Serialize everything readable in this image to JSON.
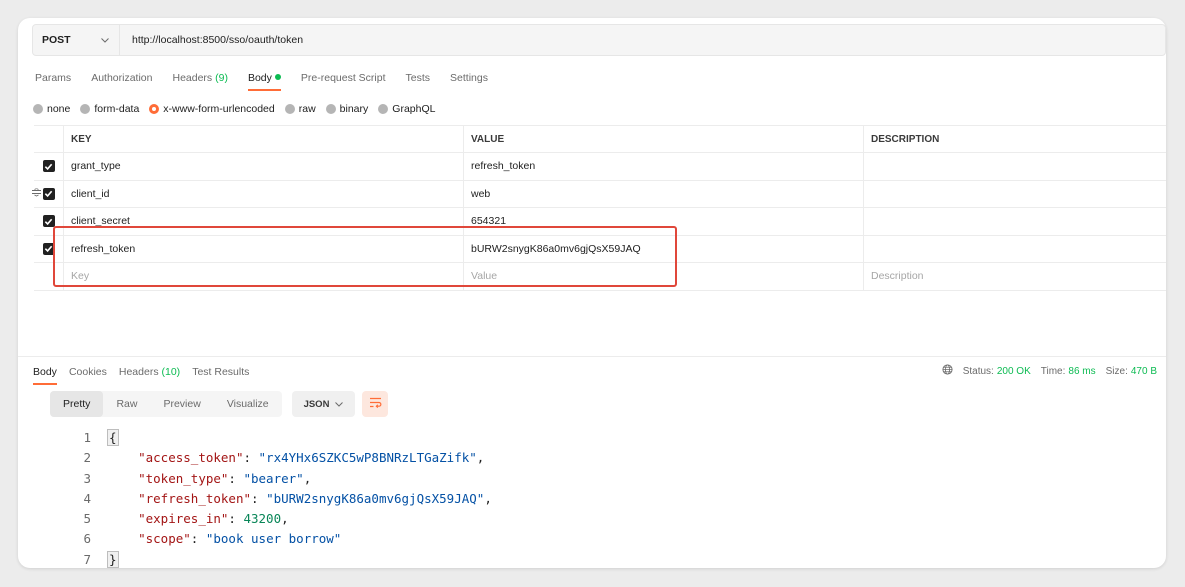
{
  "request": {
    "method": "POST",
    "url": "http://localhost:8500/sso/oauth/token"
  },
  "request_tabs": [
    {
      "label": "Params"
    },
    {
      "label": "Authorization"
    },
    {
      "label": "Headers",
      "count": "(9)"
    },
    {
      "label": "Body",
      "active": true
    },
    {
      "label": "Pre-request Script"
    },
    {
      "label": "Tests"
    },
    {
      "label": "Settings"
    }
  ],
  "body_types": [
    {
      "label": "none",
      "selected": false
    },
    {
      "label": "form-data",
      "selected": false
    },
    {
      "label": "x-www-form-urlencoded",
      "selected": true
    },
    {
      "label": "raw",
      "selected": false
    },
    {
      "label": "binary",
      "selected": false
    },
    {
      "label": "GraphQL",
      "selected": false
    }
  ],
  "table": {
    "headers": {
      "key": "KEY",
      "value": "VALUE",
      "description": "DESCRIPTION"
    },
    "rows": [
      {
        "key": "grant_type",
        "value": "refresh_token",
        "checked": true
      },
      {
        "key": "client_id",
        "value": "web",
        "checked": true
      },
      {
        "key": "client_secret",
        "value": "654321",
        "checked": true
      },
      {
        "key": "refresh_token",
        "value": "bURW2snygK86a0mv6gjQsX59JAQ",
        "checked": true
      }
    ],
    "placeholders": {
      "key": "Key",
      "value": "Value",
      "description": "Description"
    }
  },
  "response_tabs": [
    {
      "label": "Body",
      "active": true
    },
    {
      "label": "Cookies"
    },
    {
      "label": "Headers",
      "count": "(10)"
    },
    {
      "label": "Test Results"
    }
  ],
  "status": {
    "status_label": "Status:",
    "status_value": "200 OK",
    "time_label": "Time:",
    "time_value": "86 ms",
    "size_label": "Size:",
    "size_value": "470 B"
  },
  "view_tabs": [
    {
      "label": "Pretty",
      "active": true
    },
    {
      "label": "Raw"
    },
    {
      "label": "Preview"
    },
    {
      "label": "Visualize"
    }
  ],
  "format": "JSON",
  "icons": {
    "method_dropdown": "chevron-down-icon",
    "drag_handle": "drag-handle-icon",
    "globe": "globe-icon",
    "wrap": "wrap-lines-icon"
  },
  "colors": {
    "accent": "#ff6c37",
    "success": "#0cbb52",
    "highlight_box": "#e0473a",
    "json_key": "#a31515",
    "json_string": "#0451a5",
    "json_number": "#098658"
  },
  "code": [
    {
      "ln": "1",
      "open": "{"
    },
    {
      "ln": "2",
      "key": "\"access_token\"",
      "str": "\"rx4YHx6SZKC5wP8BNRzLTGaZifk\"",
      "comma": true
    },
    {
      "ln": "3",
      "key": "\"token_type\"",
      "str": "\"bearer\"",
      "comma": true
    },
    {
      "ln": "4",
      "key": "\"refresh_token\"",
      "str": "\"bURW2snygK86a0mv6gjQsX59JAQ\"",
      "comma": true
    },
    {
      "ln": "5",
      "key": "\"expires_in\"",
      "num": "43200",
      "comma": true
    },
    {
      "ln": "6",
      "key": "\"scope\"",
      "str": "\"book user borrow\"",
      "comma": false
    },
    {
      "ln": "7",
      "close": "}"
    }
  ]
}
